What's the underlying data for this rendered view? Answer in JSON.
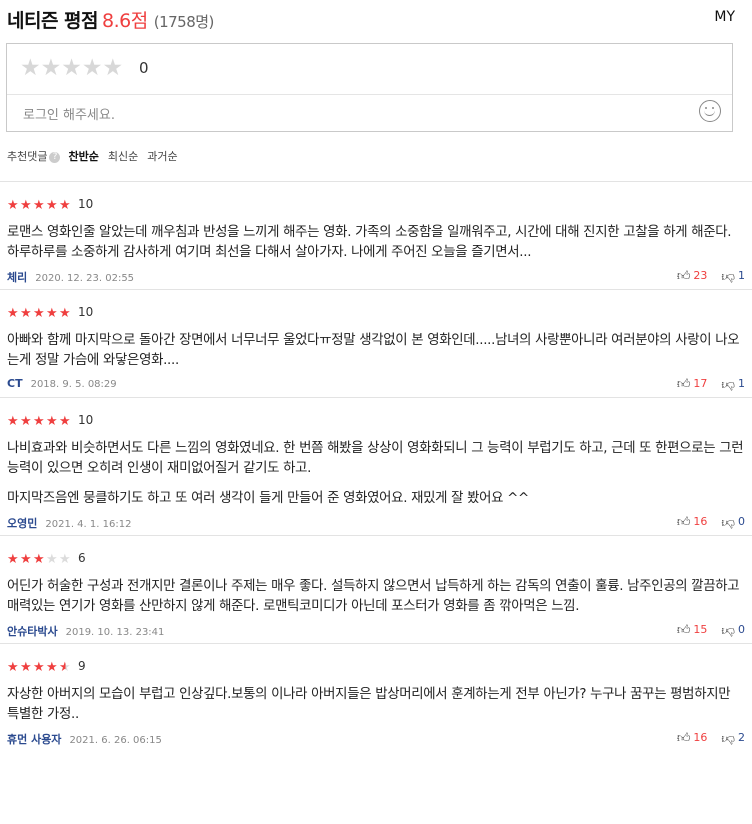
{
  "header": {
    "title": "네티즌 평점",
    "score": "8.6점",
    "count": "(1758명)",
    "my_link": "MY"
  },
  "write_box": {
    "stars_total": 5,
    "score": "0",
    "placeholder": "로그인 해주세요.",
    "emoji_icon": "smiley-icon"
  },
  "sort_bar": {
    "label": "추천댓글",
    "help": "?",
    "options": [
      "찬반순",
      "최신순",
      "과거순"
    ],
    "active": "찬반순"
  },
  "colors": {
    "accent_red": "#ef3f3f",
    "author_blue": "#2b4a8f"
  },
  "reviews": [
    {
      "stars": 5,
      "score": "10",
      "text": [
        "로맨스 영화인줄 알았는데 깨우침과 반성을 느끼게 해주는 영화. 가족의 소중함을 일깨워주고, 시간에 대해 진지한 고찰을 하게 해준다. 하루하루를 소중하게 감사하게 여기며 최선을 다해서 살아가자. 나에게 주어진 오늘을 즐기면서..."
      ],
      "author": "체리",
      "date": "2020. 12. 23. 02:55",
      "likes": "23",
      "dislikes": "1"
    },
    {
      "stars": 5,
      "score": "10",
      "text": [
        "아빠와 함께 마지막으로 돌아간 장면에서 너무너무 울었다ㅠ정말 생각없이 본 영화인데.....남녀의 사랑뿐아니라 여러분야의 사랑이 나오는게 정말 가슴에 와닿은영화...."
      ],
      "author": "CT",
      "date": "2018. 9. 5. 08:29",
      "likes": "17",
      "dislikes": "1"
    },
    {
      "stars": 5,
      "score": "10",
      "text": [
        "나비효과와 비슷하면서도 다른 느낌의 영화였네요. 한 번쯤 해봤을 상상이 영화화되니 그 능력이 부럽기도 하고, 근데 또 한편으로는 그런 능력이 있으면 오히려 인생이 재미없어질거 같기도 하고.",
        "마지막즈음엔 뭉클하기도 하고 또 여러 생각이 들게 만들어 준 영화였어요. 재밌게 잘 봤어요 ^^"
      ],
      "author": "오영민",
      "date": "2021. 4. 1. 16:12",
      "likes": "16",
      "dislikes": "0"
    },
    {
      "stars": 3,
      "score": "6",
      "text": [
        "어딘가 허술한 구성과 전개지만 결론이나 주제는 매우 좋다. 설득하지 않으면서 납득하게 하는 감독의 연출이 훌륭. 남주인공의 깔끔하고 매력있는 연기가 영화를 산만하지 않게 해준다. 로맨틱코미디가 아닌데 포스터가 영화를 좀 깎아먹은 느낌."
      ],
      "author": "안슈타박사",
      "date": "2019. 10. 13. 23:41",
      "likes": "15",
      "dislikes": "0"
    },
    {
      "stars": 4.5,
      "score": "9",
      "text": [
        "자상한 아버지의 모습이 부럽고 인상깊다.보통의 이나라 아버지들은 밥상머리에서 훈계하는게 전부 아닌가? 누구나 꿈꾸는 평범하지만 특별한 가정.."
      ],
      "author": "휴먼 사용자",
      "date": "2021. 6. 26. 06:15",
      "likes": "16",
      "dislikes": "2"
    }
  ]
}
